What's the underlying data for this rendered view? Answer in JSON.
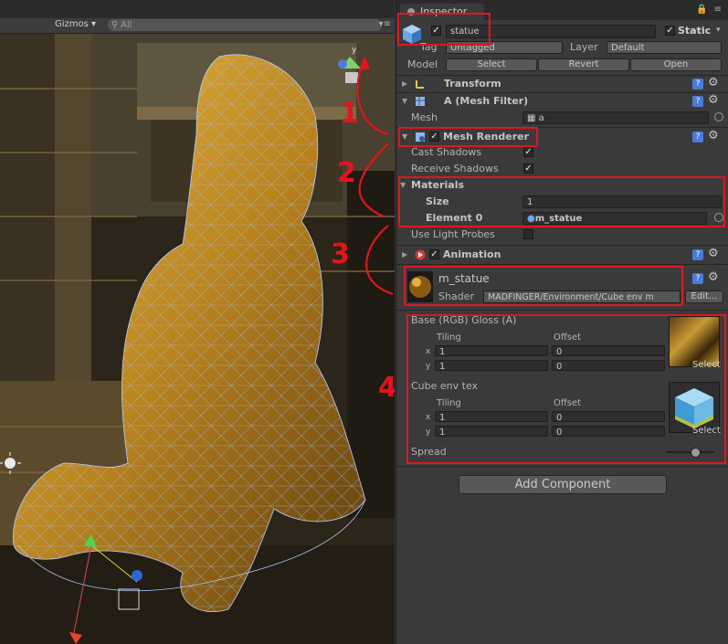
{
  "scene": {
    "gizmos_label": "Gizmos",
    "search_placeholder": "All",
    "axis_label": "y"
  },
  "inspector": {
    "tab_title": "Inspector",
    "object": {
      "name": "statue",
      "static_label": "Static",
      "tag_label": "Tag",
      "tag_value": "Untagged",
      "layer_label": "Layer",
      "layer_value": "Default",
      "model_label": "Model",
      "model_buttons": [
        "Select",
        "Revert",
        "Open"
      ]
    },
    "transform": {
      "title": "Transform"
    },
    "mesh_filter": {
      "title": "A (Mesh Filter)",
      "mesh_label": "Mesh",
      "mesh_value": "a"
    },
    "mesh_renderer": {
      "title": "Mesh Renderer",
      "cast_shadows": "Cast Shadows",
      "receive_shadows": "Receive Shadows",
      "materials_label": "Materials",
      "size_label": "Size",
      "size_value": "1",
      "element_label": "Element 0",
      "element_value": "m_statue",
      "light_probes": "Use Light Probes"
    },
    "animation": {
      "title": "Animation"
    },
    "material": {
      "name": "m_statue",
      "shader_label": "Shader",
      "shader_value": "MADFINGER/Environment/Cube env m",
      "edit_label": "Edit...",
      "base_label": "Base (RGB) Gloss (A)",
      "cube_label": "Cube env tex",
      "tiling_label": "Tiling",
      "offset_label": "Offset",
      "x_label": "x",
      "y_label": "y",
      "base_tiling_x": "1",
      "base_tiling_y": "1",
      "base_offset_x": "0",
      "base_offset_y": "0",
      "cube_tiling_x": "1",
      "cube_tiling_y": "1",
      "cube_offset_x": "0",
      "cube_offset_y": "0",
      "select_label": "Select",
      "spread_label": "Spread"
    },
    "add_component": "Add Component"
  },
  "annotations": {
    "n1": "1",
    "n2": "2",
    "n3": "3",
    "n4": "4"
  },
  "colors": {
    "annotation": "#e0161f",
    "help_icon": "#4b7bd6",
    "statue_gold": "#c8962a"
  }
}
